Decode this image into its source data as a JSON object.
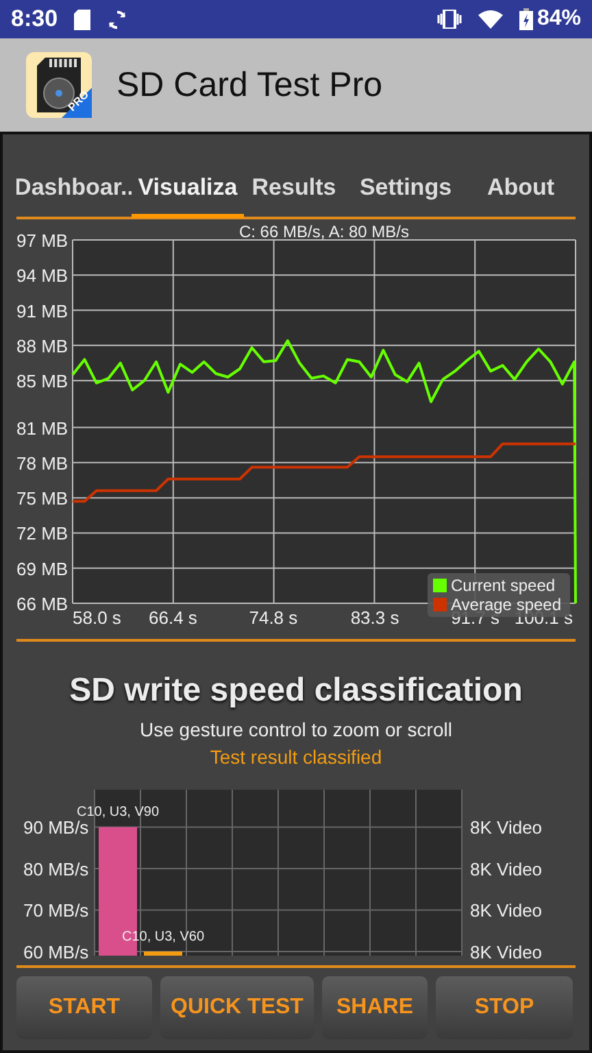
{
  "status_bar": {
    "time": "8:30",
    "battery": "84%"
  },
  "app_bar": {
    "title": "SD Card Test Pro",
    "icon_badge": "PRO"
  },
  "tabs": [
    {
      "label": "Dashboar..",
      "selected": false
    },
    {
      "label": "Visualiza",
      "selected": true
    },
    {
      "label": "Results",
      "selected": false
    },
    {
      "label": "Settings",
      "selected": false
    },
    {
      "label": "About",
      "selected": false
    }
  ],
  "speed_chart": {
    "chart_data": {
      "type": "line",
      "grid": true,
      "legend": true,
      "title": "C: 66 MB/s, A: 80 MB/s",
      "x": [
        58,
        59,
        60,
        61,
        62,
        63,
        64,
        65,
        66,
        67,
        68,
        69,
        70,
        71,
        72,
        73,
        74,
        75,
        76,
        77,
        78,
        79,
        80,
        81,
        82,
        83,
        84,
        85,
        86,
        87,
        88,
        89,
        90,
        91,
        92,
        93,
        94,
        95,
        96,
        97,
        98,
        99,
        100,
        100.1
      ],
      "series": [
        {
          "name": "Current speed",
          "color": "#66ff00",
          "values": [
            85.5,
            86.8,
            84.8,
            85.2,
            86.5,
            84.2,
            85.0,
            86.6,
            84.0,
            86.4,
            85.7,
            86.6,
            85.6,
            85.3,
            86.0,
            87.8,
            86.6,
            86.7,
            88.4,
            86.5,
            85.2,
            85.4,
            84.8,
            86.8,
            86.6,
            85.3,
            87.6,
            85.5,
            84.9,
            86.5,
            83.2,
            85.1,
            85.8,
            86.7,
            87.5,
            85.8,
            86.3,
            85.1,
            86.6,
            87.7,
            86.6,
            84.7,
            86.6,
            66
          ]
        },
        {
          "name": "Average speed",
          "color": "#cc3300",
          "values": [
            74.7,
            74.7,
            75.6,
            75.6,
            75.6,
            75.6,
            75.6,
            75.6,
            76.6,
            76.6,
            76.6,
            76.6,
            76.6,
            76.6,
            76.6,
            77.6,
            77.6,
            77.6,
            77.6,
            77.6,
            77.6,
            77.6,
            77.6,
            77.6,
            78.5,
            78.5,
            78.5,
            78.5,
            78.5,
            78.5,
            78.5,
            78.5,
            78.5,
            78.5,
            78.5,
            78.5,
            79.6,
            79.6,
            79.6,
            79.6,
            79.6,
            79.6,
            79.6,
            79.6
          ]
        }
      ],
      "xlim": [
        58,
        100.1
      ],
      "ylim": [
        66,
        97
      ],
      "xticks": [
        {
          "value": 58,
          "label": "58.0 s"
        },
        {
          "value": 66.4,
          "label": "66.4 s"
        },
        {
          "value": 74.8,
          "label": "74.8 s"
        },
        {
          "value": 83.3,
          "label": "83.3 s"
        },
        {
          "value": 91.7,
          "label": "91.7 s"
        },
        {
          "value": 100.1,
          "label": "100.1 s"
        }
      ],
      "yticks": [
        {
          "value": 66,
          "label": "66 MB"
        },
        {
          "value": 69,
          "label": "69 MB"
        },
        {
          "value": 72,
          "label": "72 MB"
        },
        {
          "value": 75,
          "label": "75 MB"
        },
        {
          "value": 78,
          "label": "78 MB"
        },
        {
          "value": 81,
          "label": "81 MB"
        },
        {
          "value": 85,
          "label": "85 MB"
        },
        {
          "value": 88,
          "label": "88 MB"
        },
        {
          "value": 91,
          "label": "91 MB"
        },
        {
          "value": 94,
          "label": "94 MB"
        },
        {
          "value": 97,
          "label": "97 MB"
        }
      ]
    }
  },
  "classification": {
    "title": "SD write speed classification",
    "subtitle": "Use gesture control to zoom or scroll",
    "status": "Test result classified",
    "chart_data": {
      "type": "bar",
      "grid": true,
      "series": [
        {
          "name": "C10, U3, V90",
          "color": "#d94f8c",
          "values": [
            90,
            null
          ]
        },
        {
          "name": "C10, U3, V60",
          "color": "#f39c12",
          "values": [
            null,
            60
          ]
        }
      ],
      "ylim": [
        59,
        99
      ],
      "stacked": true,
      "yticks": [
        {
          "value": 60,
          "label": "60 MB/s"
        },
        {
          "value": 70,
          "label": "70 MB/s"
        },
        {
          "value": 80,
          "label": "80 MB/s"
        },
        {
          "value": 90,
          "label": "90 MB/s"
        }
      ]
    },
    "right_labels": [
      "8K Video",
      "8K Video",
      "8K Video",
      "8K Video"
    ]
  },
  "buttons": [
    "START",
    "QUICK TEST",
    "SHARE",
    "STOP"
  ]
}
